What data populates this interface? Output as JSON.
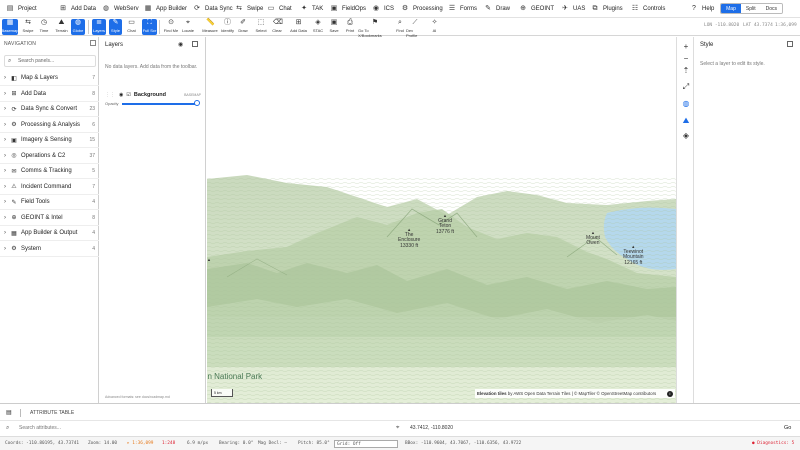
{
  "menu": {
    "items": [
      {
        "icon": "file-icon",
        "glyph": "▤",
        "label": "Project"
      },
      {
        "icon": "add-data-icon",
        "glyph": "⊞",
        "label": "Add Data"
      },
      {
        "icon": "globe-icon",
        "glyph": "◍",
        "label": "WebServ"
      },
      {
        "icon": "app-builder-icon",
        "glyph": "▦",
        "label": "App Builder"
      },
      {
        "icon": "sync-icon",
        "glyph": "⟳",
        "label": "Data Sync"
      },
      {
        "icon": "swipe-icon",
        "glyph": "⇆",
        "label": "Swipe"
      },
      {
        "icon": "chat-icon",
        "glyph": "▭",
        "label": "Chat"
      },
      {
        "icon": "tak-icon",
        "glyph": "✦",
        "label": "TAK"
      },
      {
        "icon": "fieldops-icon",
        "glyph": "▣",
        "label": "FieldOps"
      },
      {
        "icon": "ics-icon",
        "glyph": "◉",
        "label": "ICS"
      },
      {
        "icon": "processing-icon",
        "glyph": "⚙",
        "label": "Processing"
      },
      {
        "icon": "forms-icon",
        "glyph": "☰",
        "label": "Forms"
      },
      {
        "icon": "draw-icon",
        "glyph": "✎",
        "label": "Draw"
      },
      {
        "icon": "geoint-icon",
        "glyph": "⊕",
        "label": "GEOINT"
      },
      {
        "icon": "uas-icon",
        "glyph": "✈",
        "label": "UAS"
      },
      {
        "icon": "plugins-icon",
        "glyph": "⧉",
        "label": "Plugins"
      },
      {
        "icon": "controls-icon",
        "glyph": "☷",
        "label": "Controls"
      },
      {
        "icon": "help-icon",
        "glyph": "?",
        "label": "Help"
      }
    ],
    "modes": [
      "Map",
      "Split",
      "Docs"
    ]
  },
  "toolbar": {
    "tools": [
      {
        "icon": "basemap-icon",
        "glyph": "▦",
        "label": "Basemap",
        "active": true
      },
      {
        "icon": "swipe-tool-icon",
        "glyph": "⇆",
        "label": "Swipe",
        "active": false
      },
      {
        "icon": "time-icon",
        "glyph": "◷",
        "label": "Time",
        "active": false
      },
      {
        "icon": "terrain-icon",
        "glyph": "⛰",
        "label": "Terrain",
        "active": false
      },
      {
        "icon": "globe-tool-icon",
        "glyph": "◍",
        "label": "Globe",
        "active": true
      },
      {
        "icon": "layers-tool-icon",
        "glyph": "≣",
        "label": "Layers",
        "active": true
      },
      {
        "icon": "style-icon",
        "glyph": "✎",
        "label": "Style",
        "active": true
      },
      {
        "icon": "chat-tool-icon",
        "glyph": "▭",
        "label": "Chat",
        "active": false
      },
      {
        "icon": "fullscreen-icon",
        "glyph": "⛶",
        "label": "Full Scr",
        "active": true
      },
      {
        "icon": "find-me-icon",
        "glyph": "⊙",
        "label": "Find Me",
        "active": false
      },
      {
        "icon": "locate-icon",
        "glyph": "⌖",
        "label": "Locate",
        "active": false
      },
      {
        "icon": "measure-icon",
        "glyph": "📏",
        "label": "Measure",
        "active": false
      },
      {
        "icon": "identify-icon",
        "glyph": "ⓘ",
        "label": "Identify",
        "active": false
      },
      {
        "icon": "draw-tool-icon",
        "glyph": "✐",
        "label": "Draw",
        "active": false
      },
      {
        "icon": "select-icon",
        "glyph": "⬚",
        "label": "Select",
        "active": false
      },
      {
        "icon": "clear-icon",
        "glyph": "⌫",
        "label": "Clear",
        "active": false
      },
      {
        "icon": "add-data-tool-icon",
        "glyph": "⊞",
        "label": "Add Data",
        "active": false
      },
      {
        "icon": "stac-icon",
        "glyph": "◈",
        "label": "STAC",
        "active": false
      },
      {
        "icon": "save-icon",
        "glyph": "▣",
        "label": "Save",
        "active": false
      },
      {
        "icon": "print-icon",
        "glyph": "⎙",
        "label": "Print",
        "active": false
      },
      {
        "icon": "bookmark-icon",
        "glyph": "⚑",
        "label": "Go To X/Bookmarks",
        "active": false
      },
      {
        "icon": "find-icon",
        "glyph": "⌕",
        "label": "Find",
        "active": false
      },
      {
        "icon": "dev-profile-icon",
        "glyph": "⟋",
        "label": "Dev Profile",
        "active": false
      },
      {
        "icon": "ai-icon",
        "glyph": "✧",
        "label": "AI",
        "active": false
      }
    ],
    "coords_lon": "LON -110.8020",
    "coords_lat": "LAT 43.7374",
    "coords_scale": "1:36,099"
  },
  "nav": {
    "title": "NAVIGATION",
    "search_placeholder": "Search panels...",
    "items": [
      {
        "icon": "map-icon",
        "glyph": "◧",
        "label": "Map & Layers",
        "count": "7"
      },
      {
        "icon": "add-data-nav-icon",
        "glyph": "⊞",
        "label": "Add Data",
        "count": "8"
      },
      {
        "icon": "sync-nav-icon",
        "glyph": "⟳",
        "label": "Data Sync & Convert",
        "count": "23"
      },
      {
        "icon": "wrench-icon",
        "glyph": "⚙",
        "label": "Processing & Analysis",
        "count": "6"
      },
      {
        "icon": "image-icon",
        "glyph": "▣",
        "label": "Imagery & Sensing",
        "count": "15"
      },
      {
        "icon": "ops-icon",
        "glyph": "◎",
        "label": "Operations & C2",
        "count": "37"
      },
      {
        "icon": "comms-icon",
        "glyph": "✉",
        "label": "Comms & Tracking",
        "count": "5"
      },
      {
        "icon": "incident-icon",
        "glyph": "⚠",
        "label": "Incident Command",
        "count": "7"
      },
      {
        "icon": "field-tools-icon",
        "glyph": "✎",
        "label": "Field Tools",
        "count": "4"
      },
      {
        "icon": "geoint-nav-icon",
        "glyph": "⊕",
        "label": "GEOINT & Intel",
        "count": "8"
      },
      {
        "icon": "output-icon",
        "glyph": "▦",
        "label": "App Builder & Output",
        "count": "4"
      },
      {
        "icon": "system-icon",
        "glyph": "⚙",
        "label": "System",
        "count": "4"
      }
    ]
  },
  "layers": {
    "title": "Layers",
    "empty_text": "No data layers. Add data from the toolbar.",
    "background_name": "Background",
    "background_type": "BASEMAP",
    "opacity_label": "Opacity",
    "opacity_value": 1.0,
    "footer": "Advanced formats: see docs/roadmap.md"
  },
  "map": {
    "peaks": [
      {
        "name": "Grand\nTeton\n13776 ft"
      },
      {
        "name": "The\nEnclosure\n13330 ft"
      },
      {
        "name": "Mount\nOwen"
      },
      {
        "name": "Teewinot\nMountain\n12165 ft"
      }
    ],
    "park_label": "on National Park",
    "scale_label": "5 km",
    "attribution_bold": "Elevation tiles",
    "attribution_rest": " by AWS Open Data Terrain Tiles | © MapTiler © OpenStreetMap contributors",
    "info_glyph": "i"
  },
  "map_controls": [
    {
      "icon": "zoom-in-icon",
      "glyph": "+"
    },
    {
      "icon": "zoom-out-icon",
      "glyph": "−"
    },
    {
      "icon": "compass-icon",
      "glyph": "⇡"
    },
    {
      "icon": "expand-icon",
      "glyph": "⤢"
    },
    {
      "icon": "globe-ctrl-icon",
      "glyph": "◍"
    },
    {
      "icon": "terrain-ctrl-icon",
      "glyph": "⛰"
    },
    {
      "icon": "layers-ctrl-icon",
      "glyph": "◈"
    }
  ],
  "style_panel": {
    "title": "Style",
    "hint": "Select a layer to edit its style."
  },
  "attribute_table": {
    "title": "ATTRIBUTE TABLE",
    "search_placeholder": "Search attributes...",
    "location_value": "43.7412, -110.8020",
    "go_label": "Go"
  },
  "status": {
    "coords": "Coords: -110.80195, 43.73741",
    "zoom": "Zoom: 14.00",
    "scale_sel": "▸ 1:36,099",
    "ratio": "1:248",
    "speed": "6.9 m/px",
    "bearing": "Bearing: 0.0°",
    "mag": "Mag Decl: —",
    "pitch": "Pitch: 85.0°",
    "grid": "Grid: Off",
    "bbox": "BBox: -110.9604, 43.7067, -110.6356, 43.9722",
    "diagnostics": "● Diagnostics: 5"
  },
  "colors": {
    "accent": "#1e6ee8",
    "terrain_light": "#dde9cf",
    "terrain_dark": "#9cb88f",
    "water": "#b5d8ec"
  }
}
